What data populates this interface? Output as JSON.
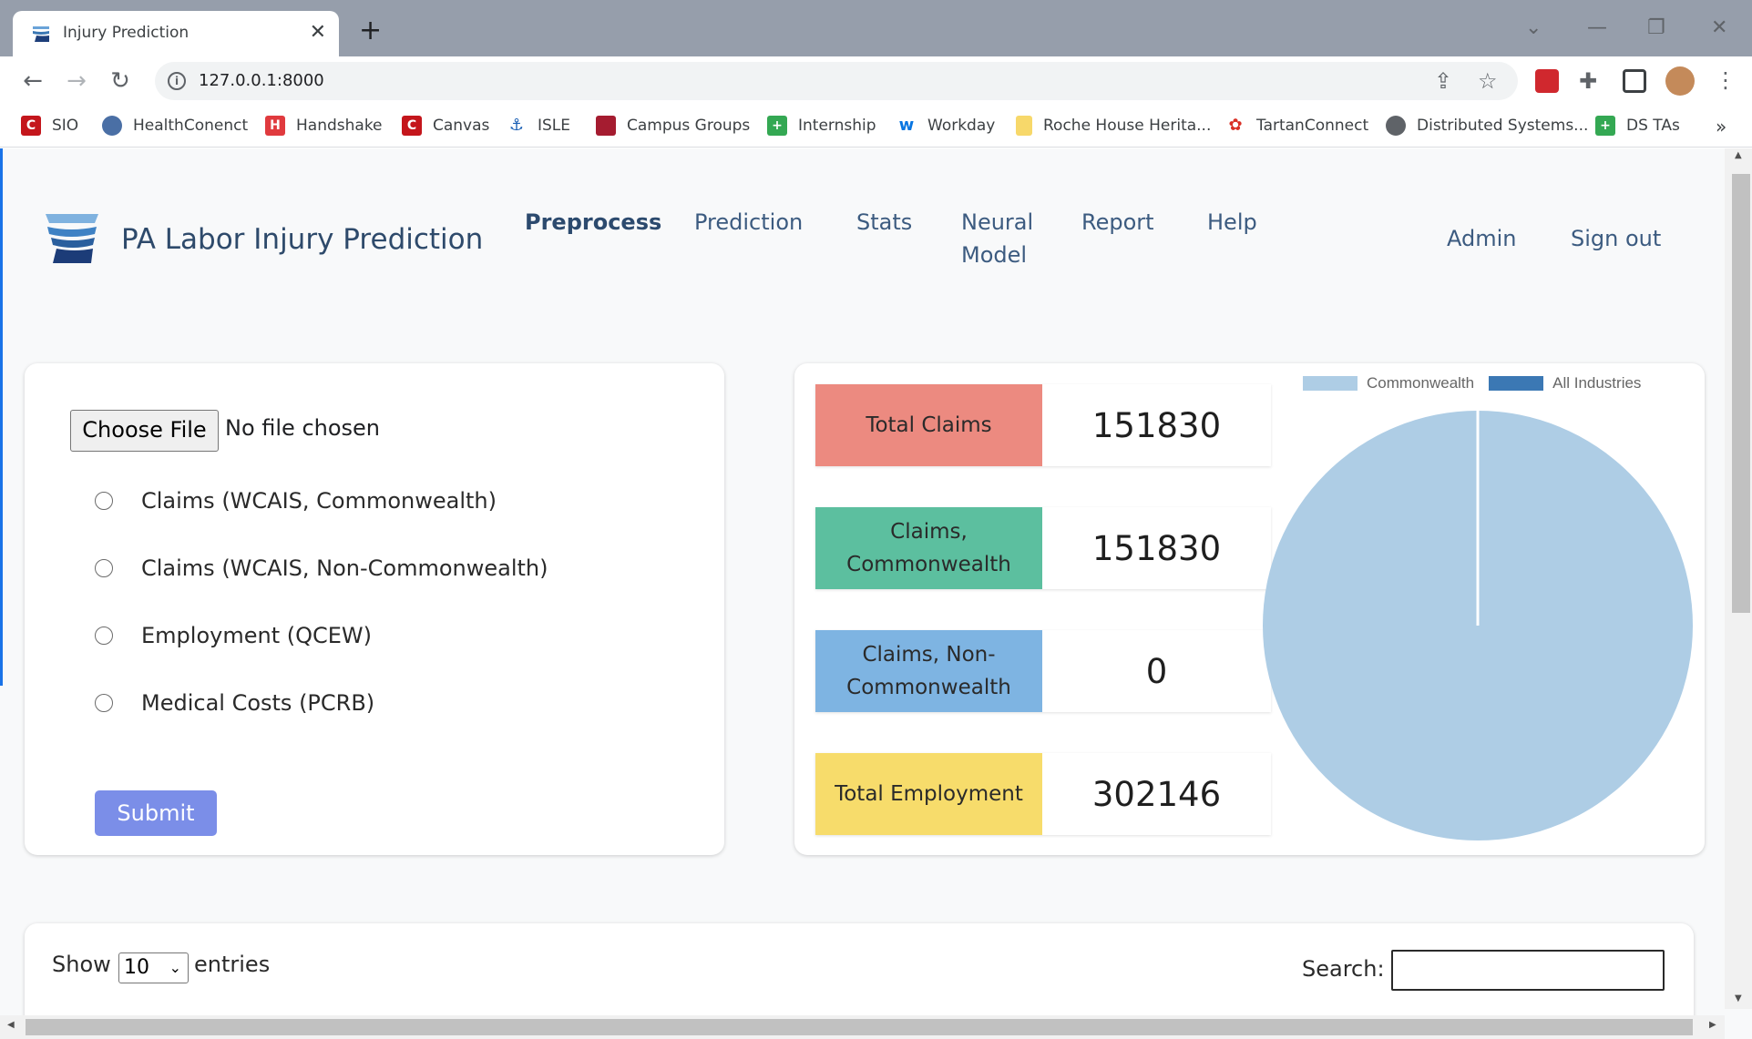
{
  "browser": {
    "tab_title": "Injury Prediction",
    "tab_close": "✕",
    "new_tab": "+",
    "url": "127.0.0.1:8000",
    "bookmarks": [
      {
        "label": "SIO",
        "color": "#c4161c",
        "glyph": "C"
      },
      {
        "label": "HealthConenct",
        "color": "#4a6fa5",
        "glyph": "◉"
      },
      {
        "label": "Handshake",
        "color": "#e03a3e",
        "glyph": "H"
      },
      {
        "label": "Canvas",
        "color": "#c4161c",
        "glyph": "C"
      },
      {
        "label": "ISLE",
        "color": "#1a5fb4",
        "glyph": "⚓"
      },
      {
        "label": "Campus Groups",
        "color": "#a51c30",
        "glyph": "▦"
      },
      {
        "label": "Internship",
        "color": "#34a853",
        "glyph": "+"
      },
      {
        "label": "Workday",
        "color": "#0875e1",
        "glyph": "w"
      },
      {
        "label": "Roche House Herita...",
        "color": "#f7d86a",
        "glyph": ""
      },
      {
        "label": "TartanConnect",
        "color": "#d93025",
        "glyph": "✿"
      },
      {
        "label": "Distributed Systems...",
        "color": "#5f6368",
        "glyph": "◍"
      },
      {
        "label": "DS TAs",
        "color": "#34a853",
        "glyph": "+"
      }
    ],
    "bookmarks_overflow": "»"
  },
  "header": {
    "brand": "PA Labor Injury Prediction",
    "nav": [
      {
        "label": "Preprocess",
        "active": true
      },
      {
        "label": "Prediction",
        "active": false
      },
      {
        "label": "Stats",
        "active": false
      },
      {
        "label": "Neural Model",
        "active": false
      },
      {
        "label": "Report",
        "active": false
      },
      {
        "label": "Help",
        "active": false
      }
    ],
    "admin": "Admin",
    "signout": "Sign out"
  },
  "upload": {
    "choose_file": "Choose File",
    "file_status": "No file chosen",
    "options": [
      "Claims (WCAIS, Commonwealth)",
      "Claims (WCAIS, Non-Commonwealth)",
      "Employment (QCEW)",
      "Medical Costs (PCRB)"
    ],
    "submit": "Submit"
  },
  "stats": [
    {
      "label": "Total Claims",
      "value": "151830",
      "color": "#ec8a80"
    },
    {
      "label": "Claims, Commonwealth",
      "value": "151830",
      "color": "#5cbf9f"
    },
    {
      "label": "Claims, Non-Commonwealth",
      "value": "0",
      "color": "#7eb4e2"
    },
    {
      "label": "Total Employment",
      "value": "302146",
      "color": "#f7dc6b"
    }
  ],
  "chart_data": {
    "type": "pie",
    "categories": [
      "Commonwealth",
      "All Industries"
    ],
    "values": [
      151830,
      0
    ],
    "colors": [
      "#aecde5",
      "#3b78b4"
    ],
    "legend_position": "top"
  },
  "table": {
    "show_label": "Show",
    "entries_value": "10",
    "entries_label": "entries",
    "search_label": "Search:"
  }
}
